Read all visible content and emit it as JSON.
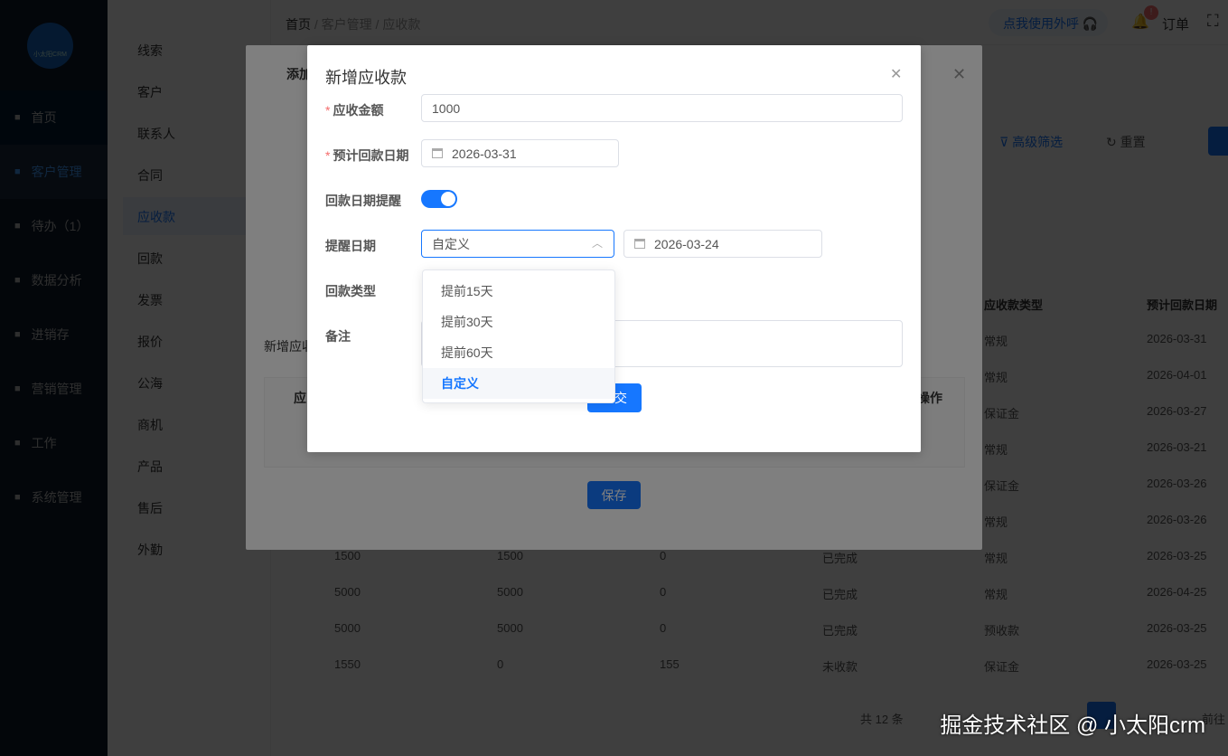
{
  "app": {
    "logo_text": "小太阳CRM"
  },
  "sidebar": {
    "items": [
      {
        "label": "首页",
        "icon": "dashboard-icon"
      },
      {
        "label": "客户管理",
        "icon": "user-icon"
      },
      {
        "label": "待办（1）",
        "icon": "sliders-icon"
      },
      {
        "label": "数据分析",
        "icon": "chart-icon"
      },
      {
        "label": "进销存",
        "icon": "folder-icon"
      },
      {
        "label": "营销管理",
        "icon": "store-icon"
      },
      {
        "label": "工作",
        "icon": "book-icon"
      },
      {
        "label": "系统管理",
        "icon": "gear-icon"
      }
    ]
  },
  "subnav": {
    "items": [
      "线索",
      "客户",
      "联系人",
      "合同",
      "应收款",
      "回款",
      "发票",
      "报价",
      "公海",
      "商机",
      "产品",
      "售后",
      "外勤"
    ],
    "active": "应收款"
  },
  "header": {
    "breadcrumb": [
      "首页",
      "客户管理",
      "应收款"
    ],
    "call_button": "点我使用外呼",
    "notification_count": "!",
    "orders": "订单"
  },
  "toolbar": {
    "advanced_filter": "高级筛选",
    "reset": "重置"
  },
  "table": {
    "headers_visible": [
      "应收款类型",
      "预计回款日期"
    ],
    "rows": [
      [
        "",
        "",
        "",
        "",
        "常规",
        "2026-03-31"
      ],
      [
        "",
        "",
        "",
        "",
        "常规",
        "2026-04-01"
      ],
      [
        "",
        "",
        "",
        "",
        "保证金",
        "2026-03-27"
      ],
      [
        "",
        "",
        "",
        "",
        "常规",
        "2026-03-21"
      ],
      [
        "",
        "",
        "",
        "",
        "保证金",
        "2026-03-26"
      ],
      [
        "",
        "",
        "",
        "",
        "常规",
        "2026-03-26"
      ],
      [
        "1500",
        "1500",
        "0",
        "已完成",
        "常规",
        "2026-03-25"
      ],
      [
        "5000",
        "5000",
        "0",
        "已完成",
        "常规",
        "2026-04-25"
      ],
      [
        "5000",
        "5000",
        "0",
        "已完成",
        "预收款",
        "2026-03-25"
      ],
      [
        "1550",
        "0",
        "155",
        "未收款",
        "保证金",
        "2026-03-25"
      ]
    ]
  },
  "pagination": {
    "total": "共 12 条",
    "goto": "前往"
  },
  "modal_back": {
    "title": "添加",
    "section": "新增应收",
    "col_first": "应",
    "col_ops": "操作",
    "save": "保存"
  },
  "modal": {
    "title": "新增应收款",
    "amount_label": "应收金额",
    "amount_value": "1000",
    "due_label": "预计回款日期",
    "due_value": "2026-03-31",
    "remind_label": "回款日期提醒",
    "remind_on": true,
    "remind_date_label": "提醒日期",
    "remind_select": "自定义",
    "remind_date_value": "2026-03-24",
    "type_label": "回款类型",
    "remark_label": "备注",
    "submit": "交",
    "options": [
      "提前15天",
      "提前30天",
      "提前60天",
      "自定义"
    ],
    "selected_option": "自定义"
  },
  "colors": {
    "primary": "#1677ff",
    "sidebar": "#0c1a2b"
  },
  "watermark": "掘金技术社区 @ 小太阳crm"
}
